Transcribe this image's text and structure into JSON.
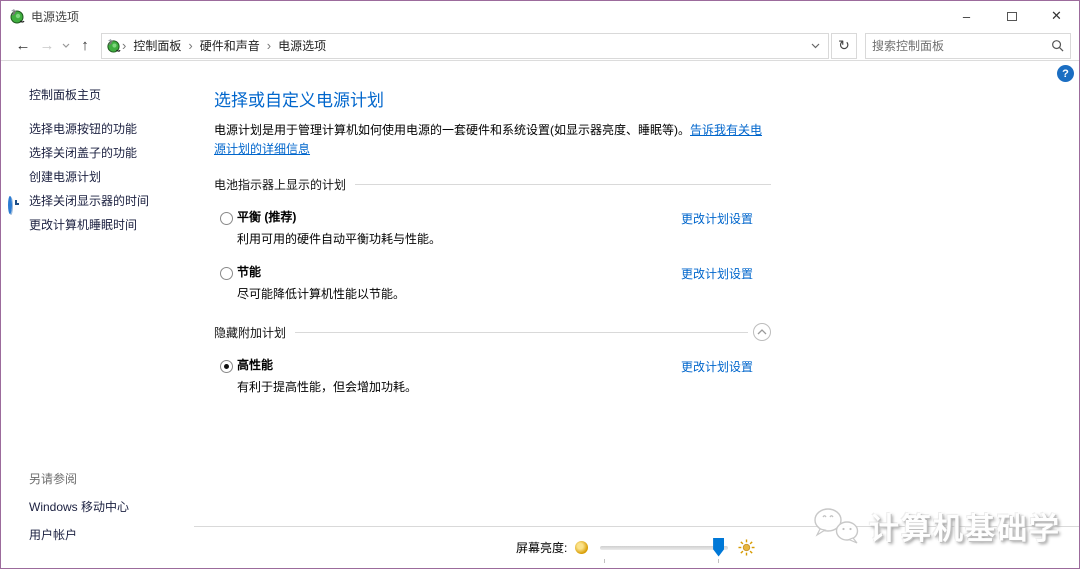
{
  "window": {
    "title": "电源选项"
  },
  "toolbar": {
    "breadcrumb": {
      "items": [
        "控制面板",
        "硬件和声音",
        "电源选项"
      ]
    },
    "search_placeholder": "搜索控制面板"
  },
  "sidebar": {
    "home_label": "控制面板主页",
    "tasks": [
      {
        "label": "选择电源按钮的功能"
      },
      {
        "label": "选择关闭盖子的功能"
      },
      {
        "label": "创建电源计划"
      },
      {
        "label": "选择关闭显示器的时间",
        "icon": "clock-icon"
      },
      {
        "label": "更改计算机睡眠时间",
        "icon": "sleep-icon"
      }
    ],
    "see_also_header": "另请参阅",
    "see_also_items": [
      "Windows 移动中心",
      "用户帐户"
    ]
  },
  "main": {
    "heading": "选择或自定义电源计划",
    "intro_text": "电源计划是用于管理计算机如何使用电源的一套硬件和系统设置(如显示器亮度、睡眠等)。",
    "intro_link": "告诉我有关电源计划的详细信息",
    "battery_section_label": "电池指示器上显示的计划",
    "hidden_section_label": "隐藏附加计划",
    "change_link": "更改计划设置",
    "plans": [
      {
        "name": "平衡 (推荐)",
        "description": "利用可用的硬件自动平衡功耗与性能。",
        "selected": false
      },
      {
        "name": "节能",
        "description": "尽可能降低计算机性能以节能。",
        "selected": false
      },
      {
        "name": "高性能",
        "description": "有利于提高性能，但会增加功耗。",
        "selected": true
      }
    ]
  },
  "bottom_bar": {
    "brightness_label": "屏幕亮度:",
    "slider_percent": 92
  },
  "watermark": {
    "text": "计算机基础学"
  },
  "colors": {
    "link_blue": "#0066cc",
    "heading_blue": "#0066cc",
    "slider_thumb_blue": "#0078d7",
    "sun_amber": "#d79b00",
    "help_blue": "#1b6ec2"
  }
}
